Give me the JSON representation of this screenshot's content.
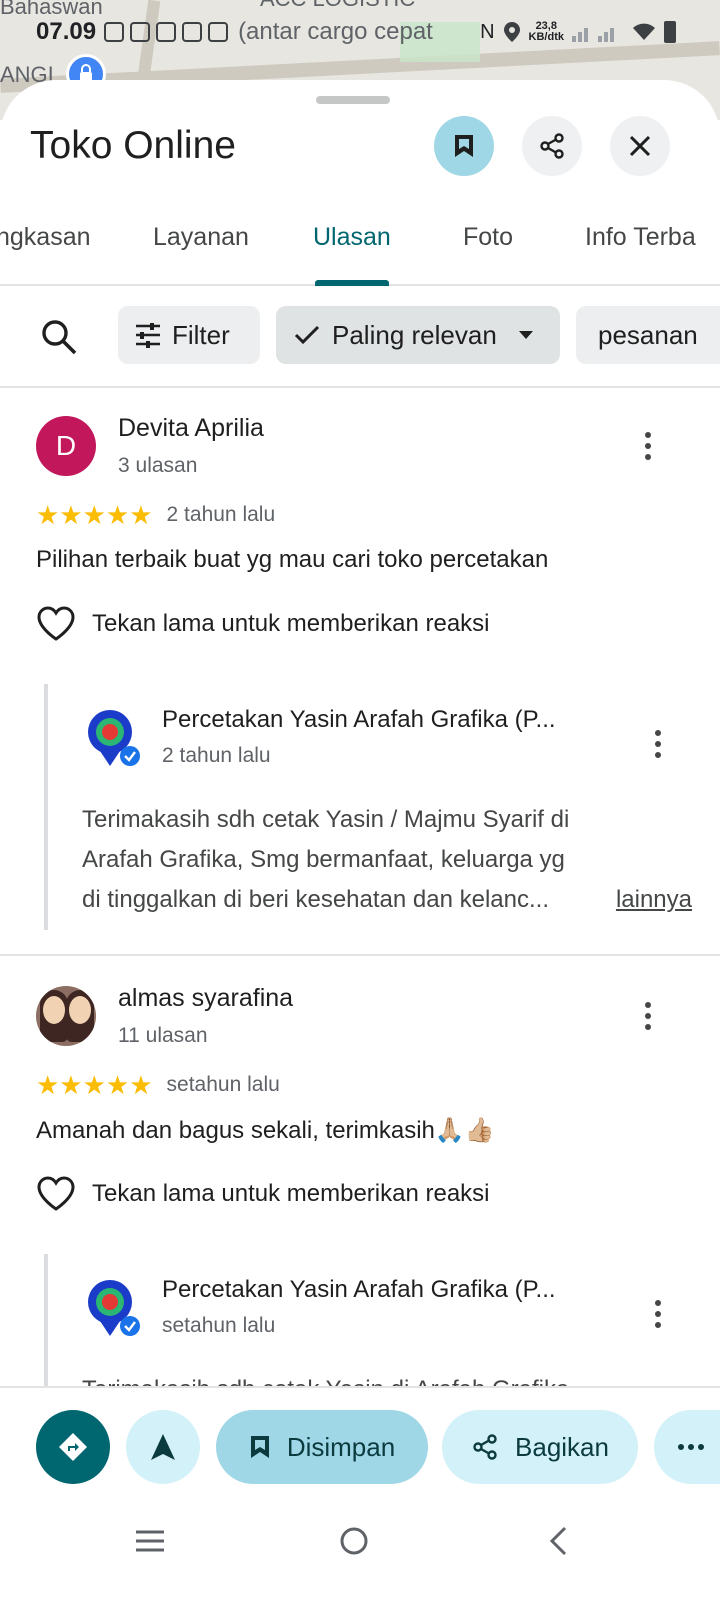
{
  "map": {
    "label_top_left": "Bahaswan",
    "label_left": "ANGI",
    "label_top": "ACC LOGISTIC",
    "overlay_text": "(antar cargo cepat"
  },
  "status_bar": {
    "time": "07.09",
    "speed_value": "23,8",
    "speed_unit": "KB/dtk"
  },
  "place": {
    "title": "Toko Online"
  },
  "tabs": [
    {
      "label": "ngkasan",
      "active": false
    },
    {
      "label": "Layanan",
      "active": false
    },
    {
      "label": "Ulasan",
      "active": true
    },
    {
      "label": "Foto",
      "active": false
    },
    {
      "label": "Info Terba",
      "active": false
    }
  ],
  "filters": {
    "filter_label": "Filter",
    "sort_label": "Paling relevan",
    "chip_pesanan": "pesanan"
  },
  "reviews": [
    {
      "avatar_letter": "D",
      "name": "Devita Aprilia",
      "review_count": "3 ulasan",
      "stars": "★★★★★",
      "rating": 5,
      "time": "2 tahun lalu",
      "text": "Pilihan terbaik buat yg mau cari toko percetakan",
      "react_text": "Tekan lama untuk memberikan reaksi",
      "owner_reply": {
        "name": "Percetakan Yasin Arafah Grafika (P...",
        "time": "2 tahun lalu",
        "line1": "Terimakasih sdh cetak Yasin / Majmu Syarif di",
        "line2": "Arafah Grafika, Smg bermanfaat, keluarga yg",
        "line3": "di tinggalkan di beri kesehatan dan kelanc...",
        "more_link": "lainnya"
      }
    },
    {
      "avatar_letter": "",
      "name": "almas syarafina",
      "review_count": "11 ulasan",
      "stars": "★★★★★",
      "rating": 5,
      "time": "setahun lalu",
      "text": "Amanah dan bagus sekali, terimkasih🙏🏼👍🏼",
      "react_text": "Tekan lama untuk memberikan reaksi",
      "owner_reply": {
        "name": "Percetakan Yasin Arafah Grafika (P...",
        "time": "setahun lalu",
        "line1": "Terimakasih sdh cetak Yasin di Arafah Grafika,"
      }
    }
  ],
  "actions": {
    "saved_label": "Disimpan",
    "share_label": "Bagikan"
  },
  "colors": {
    "accent": "#00666f",
    "saved_bg": "#9fd7e6",
    "chip_bg": "#d3f1f8",
    "star": "#fbbc04",
    "avatar_d": "#c2185b"
  }
}
